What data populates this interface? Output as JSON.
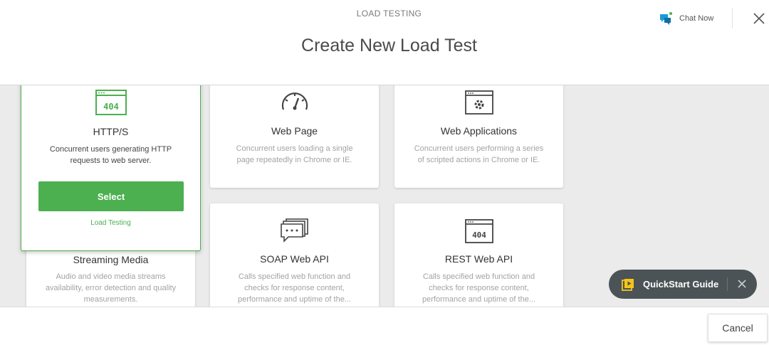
{
  "header": {
    "section_label": "LOAD TESTING",
    "title": "Create New Load Test",
    "chat_label": "Chat Now",
    "chat_icon": "chat-bubbles-icon",
    "close_icon": "close-icon"
  },
  "cards": [
    {
      "title": "HTTP/S",
      "description": "Concurrent users generating HTTP requests to web server.",
      "icon": "http-404-window-icon",
      "selected": true,
      "select_label": "Select",
      "tag": "Load Testing",
      "info_glyph": "i"
    },
    {
      "title": "Web Page",
      "description": "Concurrent users loading a single page repeatedly in Chrome or IE.",
      "icon": "speedometer-icon"
    },
    {
      "title": "Web Applications",
      "description": "Concurrent users performing a series of scripted actions in Chrome or IE.",
      "icon": "browser-gear-icon"
    },
    {
      "title": "Streaming Media",
      "description": "Audio and video media streams availability, error detection and quality measurements.",
      "icon": "media-icon"
    },
    {
      "title": "SOAP Web API",
      "description": "Calls specified web function and checks for response content, performance and uptime of the...",
      "icon": "message-stack-icon"
    },
    {
      "title": "REST Web API",
      "description": "Calls specified web function and checks for response content, performance and uptime of the...",
      "icon": "rest-404-window-icon"
    }
  ],
  "quickstart": {
    "label": "QuickStart Guide",
    "icon": "play-guide-icon",
    "close_icon": "close-icon"
  },
  "footer": {
    "cancel_label": "Cancel"
  },
  "colors": {
    "accent_green": "#4caf50",
    "quickstart_bg": "#4b5357",
    "quickstart_icon": "#f5c518",
    "chat_icon": "#1a9ad6"
  }
}
